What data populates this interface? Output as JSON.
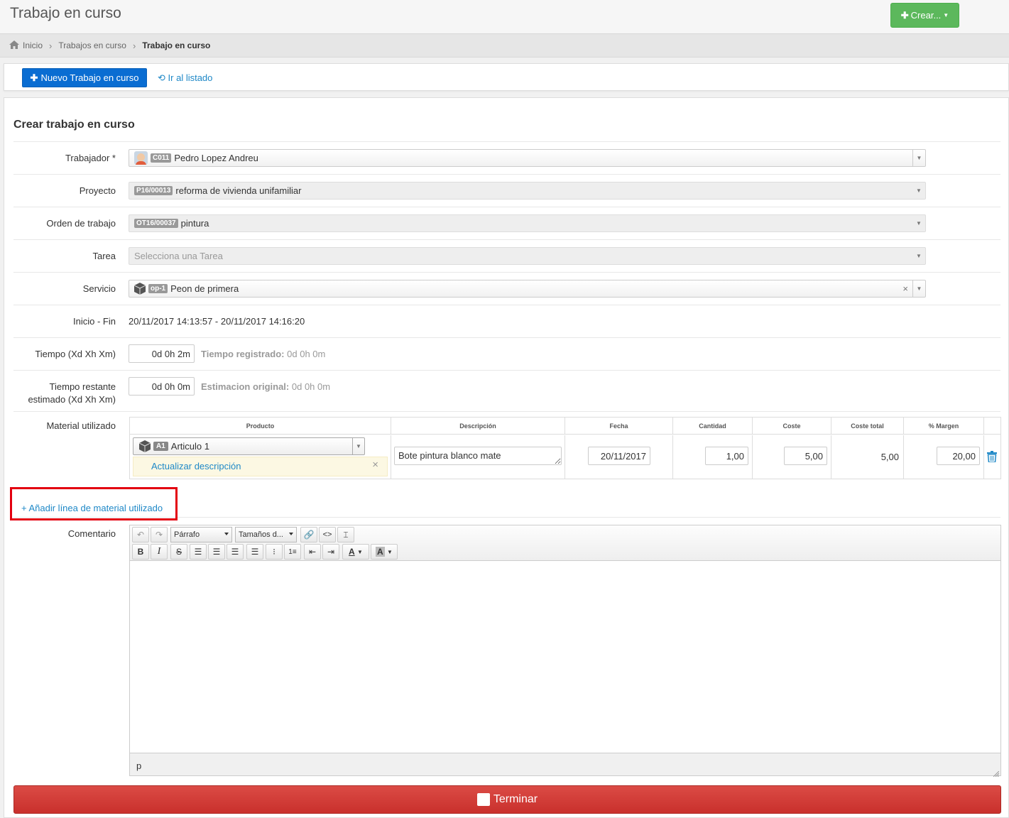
{
  "header": {
    "title": "Trabajo en curso",
    "create_button": "Crear..."
  },
  "breadcrumb": {
    "home": "Inicio",
    "list": "Trabajos en curso",
    "current": "Trabajo en curso"
  },
  "actions": {
    "new_button": "Nuevo Trabajo en curso",
    "list_link": "Ir al listado"
  },
  "form": {
    "title": "Crear trabajo en curso",
    "trabajador": {
      "label": "Trabajador *",
      "code": "C011",
      "value": "Pedro Lopez Andreu"
    },
    "proyecto": {
      "label": "Proyecto",
      "code": "P16/00013",
      "value": "reforma de vivienda unifamiliar"
    },
    "orden": {
      "label": "Orden de trabajo",
      "code": "OT16/00037",
      "value": "pintura"
    },
    "tarea": {
      "label": "Tarea",
      "placeholder": "Selecciona una Tarea"
    },
    "servicio": {
      "label": "Servicio",
      "code": "op-1",
      "value": "Peon de primera"
    },
    "inicio_fin": {
      "label": "Inicio - Fin",
      "value": "20/11/2017 14:13:57 - 20/11/2017 14:16:20"
    },
    "tiempo": {
      "label": "Tiempo (Xd Xh Xm)",
      "value": "0d 0h 2m",
      "info_label": "Tiempo registrado:",
      "info_value": "0d 0h 0m"
    },
    "restante": {
      "label_line1": "Tiempo restante",
      "label_line2": "estimado (Xd Xh Xm)",
      "value": "0d 0h 0m",
      "info_label": "Estimacion original:",
      "info_value": "0d 0h 0m"
    },
    "material": {
      "label": "Material utilizado",
      "headers": {
        "producto": "Producto",
        "descripcion": "Descripción",
        "fecha": "Fecha",
        "cantidad": "Cantidad",
        "coste": "Coste",
        "coste_total": "Coste total",
        "margen": "% Margen"
      },
      "row": {
        "code": "A1",
        "product": "Articulo 1",
        "update_link": "Actualizar descripción",
        "descripcion": "Bote pintura blanco mate",
        "fecha": "20/11/2017",
        "cantidad": "1,00",
        "coste": "5,00",
        "coste_total": "5,00",
        "margen": "20,00"
      },
      "add_line": "+ Añadir línea de material utilizado"
    },
    "comentario": {
      "label": "Comentario",
      "format_select": "Párrafo",
      "size_select": "Tamaños d...",
      "status_path": "p"
    },
    "submit_label": "Terminar"
  },
  "colors": {
    "primary": "#0a6dd2",
    "success": "#5cb85c",
    "danger": "#c9302c",
    "link": "#1e88c7",
    "highlight": "#e3000f"
  }
}
